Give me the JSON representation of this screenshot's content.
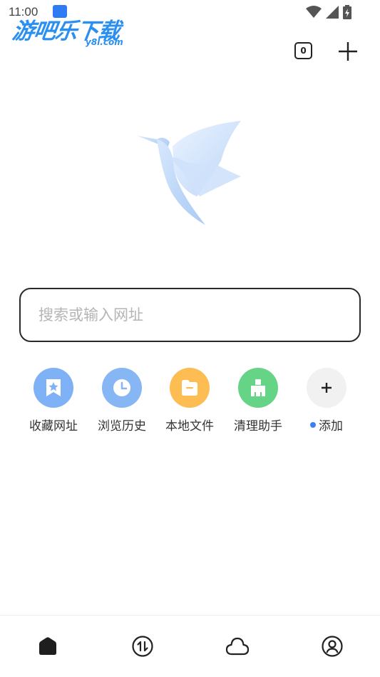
{
  "status_bar": {
    "time": "11:00"
  },
  "watermark": {
    "title": "游吧乐下载",
    "subtitle": "y8l.com"
  },
  "toolbar": {
    "tab_count": "0"
  },
  "search": {
    "placeholder": "搜索或输入网址"
  },
  "shortcuts": [
    {
      "label": "收藏网址",
      "icon": "bookmark-star-icon",
      "color": "#7eb1f5"
    },
    {
      "label": "浏览历史",
      "icon": "clock-icon",
      "color": "#87b6f4"
    },
    {
      "label": "本地文件",
      "icon": "folder-icon",
      "color": "#fdbd52"
    },
    {
      "label": "清理助手",
      "icon": "broom-icon",
      "color": "#66d487"
    },
    {
      "label": "添加",
      "icon": "plus-icon",
      "color": "#f1f1f1"
    }
  ],
  "bottom_nav": [
    {
      "name": "home",
      "icon": "home-icon"
    },
    {
      "name": "transfer",
      "icon": "transfer-icon"
    },
    {
      "name": "cloud",
      "icon": "cloud-icon"
    },
    {
      "name": "profile",
      "icon": "user-icon"
    }
  ]
}
